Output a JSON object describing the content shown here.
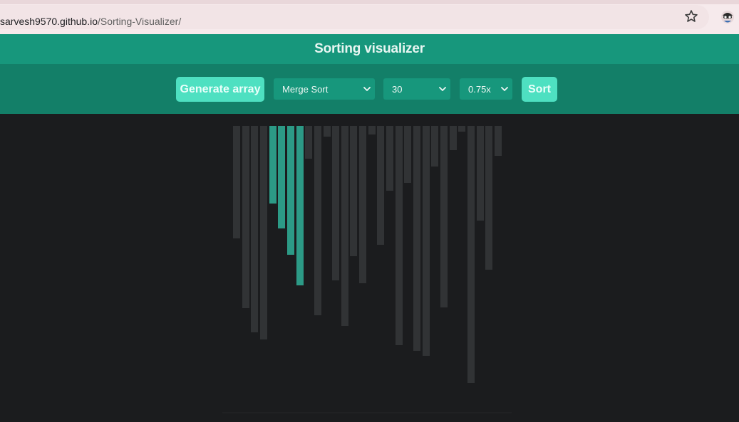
{
  "browser": {
    "url_host": "sarvesh9570.github.io",
    "url_path": "/Sorting-Visualizer/",
    "bookmark_icon": "star-icon",
    "profile_icon": "profile-avatar-icon"
  },
  "app": {
    "title": "Sorting visualizer"
  },
  "toolbar": {
    "generate_label": "Generate array",
    "algorithm_selected": "Merge Sort",
    "size_selected": "30",
    "speed_selected": "0.75x",
    "sort_label": "Sort",
    "dropdown_icon": "chevron-down-icon"
  },
  "colors": {
    "header": "#17977c",
    "toolbar": "#137f68",
    "button": "#4ee0c1",
    "bar": "#313335",
    "bar_active": "#2c9a86",
    "background": "#1b1c1e"
  },
  "bars": {
    "max_value": 400,
    "values": [
      158,
      256,
      290,
      300,
      109,
      144,
      181,
      224,
      46,
      266,
      15,
      217,
      281,
      183,
      221,
      12,
      167,
      91,
      308,
      80,
      316,
      323,
      57,
      255,
      34,
      8,
      361,
      133,
      202,
      42
    ],
    "active_indices": [
      4,
      5,
      6,
      7
    ]
  }
}
